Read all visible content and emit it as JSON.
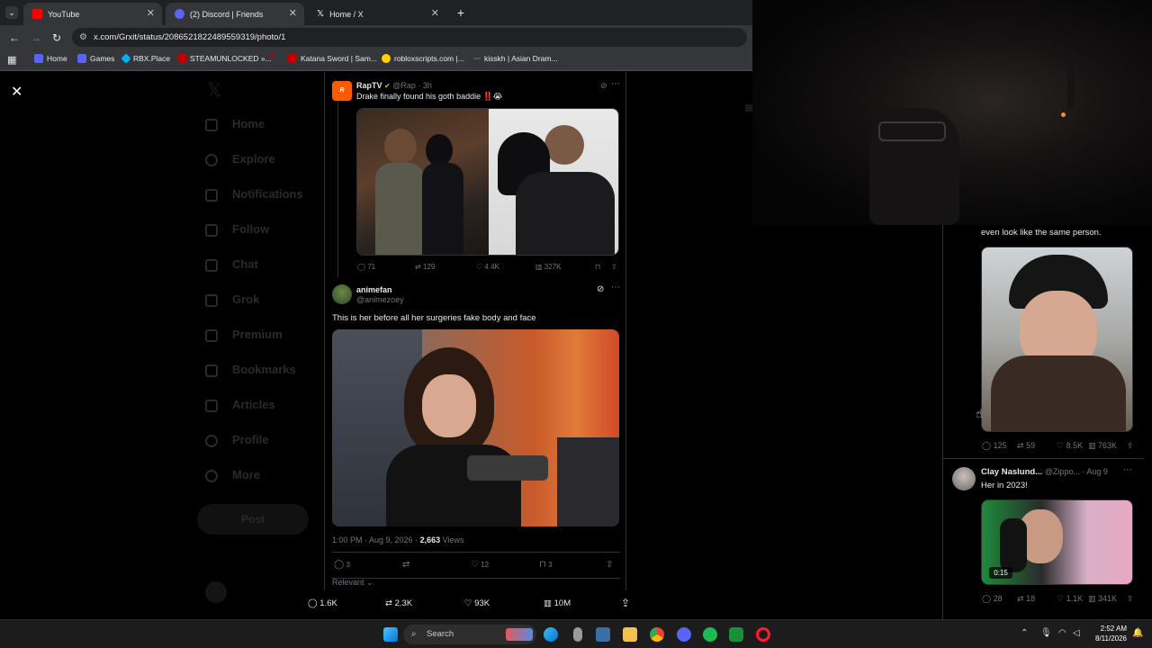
{
  "browser": {
    "tabs": [
      {
        "title": "YouTube",
        "icon": "youtube-icon",
        "color": "#ff0000"
      },
      {
        "title": "(2) Discord | Friends",
        "icon": "discord-icon",
        "color": "#5865f2"
      },
      {
        "title": "Home / X",
        "icon": "x-icon",
        "color": "#ffffff"
      }
    ],
    "url": "x.com/Grxit/status/2086521822489559319/photo/1",
    "bookmarks": [
      {
        "label": "Home",
        "color": "#5865f2"
      },
      {
        "label": "Games",
        "color": "#5865f2"
      },
      {
        "label": "RBX.Place",
        "color": "#00b0ff"
      },
      {
        "label": "STEAMUNLOCKED »...",
        "color": "#c00000"
      },
      {
        "label": "Katana Sword | Sam...",
        "color": "#c00000"
      },
      {
        "label": "robloxscripts.com |...",
        "color": "#ffd400"
      },
      {
        "label": "kisskh | Asian Dram...",
        "color": "#888888"
      }
    ]
  },
  "quoted_post": {
    "name": "RapTV",
    "handle": "@Rap · 3h",
    "text": "Drake finally found his goth baddie ‼️😭",
    "stats": {
      "replies": "71",
      "reposts": "129",
      "likes": "4.4K",
      "views": "327K"
    }
  },
  "main_post": {
    "name": "animefan",
    "handle": "@animezoey",
    "text": "This is her before all her surgeries fake body and face",
    "meta_time": "1:00 PM · Aug 9, 2026 · ",
    "meta_views": "2,663",
    "meta_views_label": " Views",
    "stats": {
      "replies": "3",
      "likes": "12",
      "bookmarks": "3"
    },
    "sort_label": "Relevant"
  },
  "photo_actions": {
    "replies": "1.6K",
    "reposts": "2.3K",
    "likes": "93K",
    "views": "10M"
  },
  "right_column": {
    "reply1_text": "even look like the same person.",
    "reply1_stats": {
      "replies": "125",
      "reposts": "59",
      "likes": "8.5K",
      "views": "763K"
    },
    "reply2_name": "Clay Naslund...",
    "reply2_handle": "@Zippo... · Aug 9",
    "reply2_text": "Her in 2023!",
    "reply2_video_time": "0:15",
    "reply2_stats": {
      "replies": "28",
      "reposts": "18",
      "likes": "1.1K",
      "views": "341K"
    }
  },
  "background_nav": [
    "Home",
    "Explore",
    "Notifications",
    "Follow",
    "Chat",
    "Grok",
    "Premium",
    "Bookmarks",
    "Articles",
    "Profile",
    "More"
  ],
  "background_post_btn": "Post",
  "taskbar": {
    "search_placeholder": "Search",
    "time": "2:52 AM",
    "date": "8/11/2026"
  }
}
